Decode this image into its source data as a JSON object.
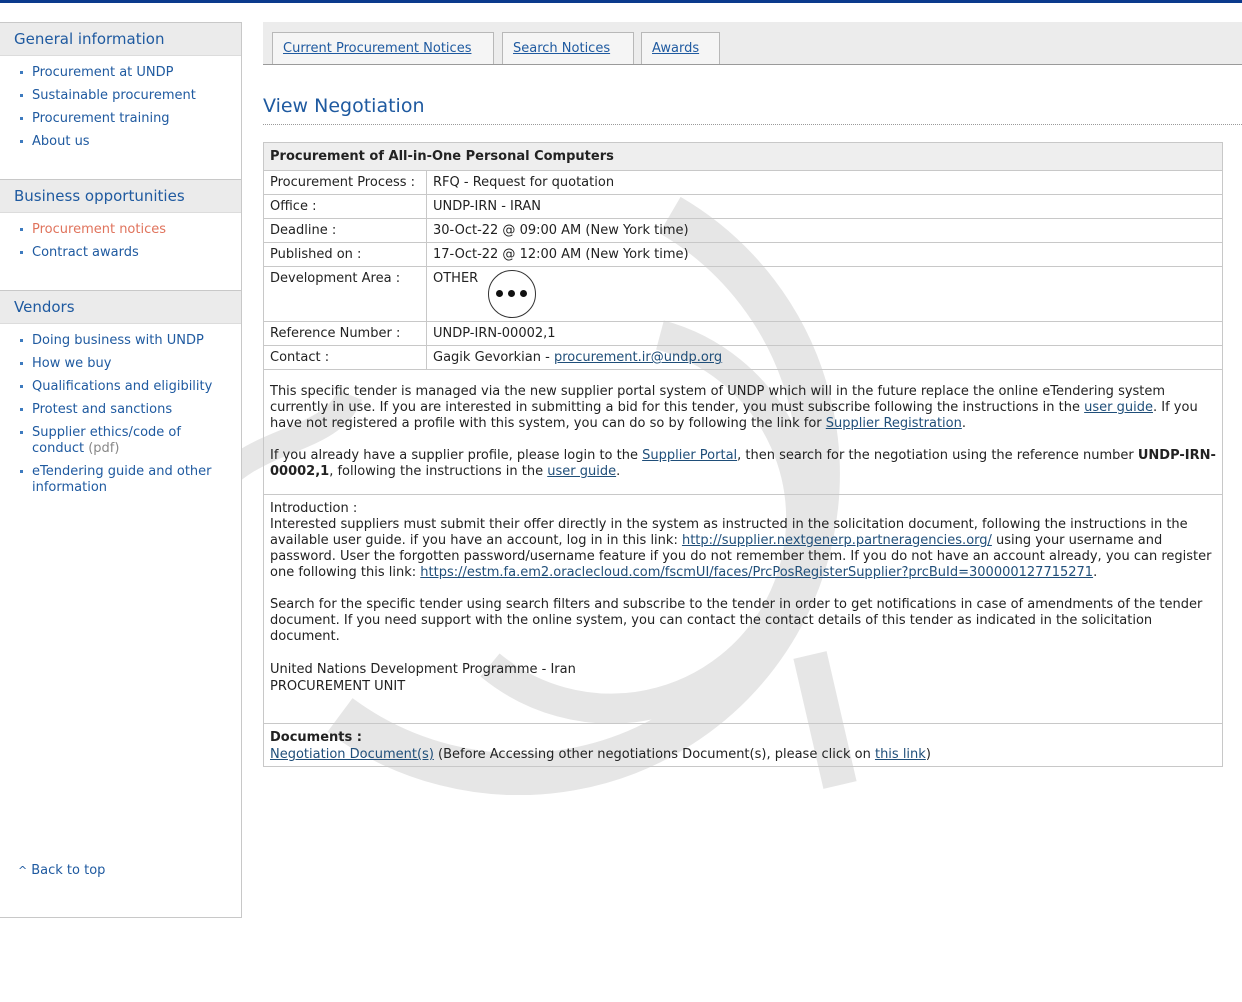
{
  "sidebar": {
    "sections": [
      {
        "title": "General information",
        "items": [
          "Procurement at UNDP",
          "Sustainable procurement",
          "Procurement training",
          "About us"
        ]
      },
      {
        "title": "Business opportunities",
        "items": [
          "Procurement notices",
          "Contract awards"
        ],
        "active": "Procurement notices"
      },
      {
        "title": "Vendors",
        "items": [
          "Doing business with UNDP",
          "How we buy",
          "Qualifications and eligibility",
          "Protest and sanctions",
          "Supplier ethics/code of conduct",
          "eTendering guide and other information"
        ],
        "pdf_suffix": "(pdf)"
      }
    ],
    "back_to_top": "Back to top"
  },
  "tabs": [
    "Current Procurement Notices",
    "Search Notices",
    "Awards"
  ],
  "page_title": "View Negotiation",
  "notice": {
    "title": "Procurement of All-in-One Personal Computers",
    "fields": [
      {
        "label": "Procurement Process :",
        "value": "RFQ - Request for quotation"
      },
      {
        "label": "Office :",
        "value": "UNDP-IRN - IRAN"
      },
      {
        "label": "Deadline :",
        "value": "30-Oct-22 @ 09:00 AM (New York time)"
      },
      {
        "label": "Published on :",
        "value": "17-Oct-22 @ 12:00 AM (New York time)"
      },
      {
        "label": "Development Area :",
        "value": "OTHER"
      },
      {
        "label": "Reference Number :",
        "value": "UNDP-IRN-00002,1"
      }
    ],
    "contact_label": "Contact :",
    "contact_name": "Gagik Gevorkian -",
    "contact_email": "procurement.ir@undp.org"
  },
  "info": {
    "p1_a": "This specific tender is managed via the new supplier portal system of UNDP which will in the future replace the online eTendering system currently in use. If you are interested in submitting a bid for this tender, you must subscribe following the instructions in the",
    "p1_link1": "user guide",
    "p1_b": ". If you have not registered a profile with this system, you can do so by following the link for",
    "p1_link2": "Supplier Registration",
    "p1_c": ".",
    "p2_a": "If you already have a supplier profile, please login to the",
    "p2_link1": "Supplier Portal",
    "p2_b": ", then search for the negotiation using the reference number",
    "p2_ref": "UNDP-IRN-00002,1",
    "p2_c": ", following the instructions in the",
    "p2_link2": "user guide",
    "p2_d": "."
  },
  "intro": {
    "label": "Introduction :",
    "p1_a": "Interested suppliers must submit their offer directly in the system as instructed in the solicitation document, following the instructions in the available user guide. if you have an account, log in in this link:",
    "p1_link1": "http://supplier.nextgenerp.partneragencies.org/",
    "p1_b": "using your username and password. User the forgotten password/username feature if you do not remember them. If you do not have an account already, you can register one following this link:",
    "p1_link2": "https://estm.fa.em2.oraclecloud.com/fscmUI/faces/PrcPosRegisterSupplier?prcBuId=300000127715271",
    "p1_c": ".",
    "p2": "Search for the specific tender using search filters and subscribe to the tender in order to get notifications in case of amendments of the tender document. If you need support with the online system, you can contact the contact details of this tender as indicated in the solicitation document.",
    "sign1": "United Nations Development Programme - Iran",
    "sign2": "PROCUREMENT UNIT"
  },
  "documents": {
    "label": "Documents :",
    "link1": "Negotiation Document(s)",
    "text_a": "(Before Accessing other negotiations Document(s), please click on",
    "link2": "this link",
    "text_b": ")"
  },
  "colors": {
    "accent": "#1f5aa0",
    "active_link": "#e0735c",
    "top_bar": "#0a3a8c"
  }
}
